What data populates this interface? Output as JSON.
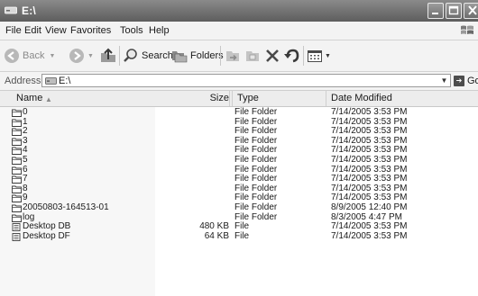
{
  "window": {
    "title": "E:\\"
  },
  "menu": {
    "file": "File",
    "edit": "Edit",
    "view": "View",
    "favorites": "Favorites",
    "tools": "Tools",
    "help": "Help"
  },
  "toolbar": {
    "back": "Back",
    "search": "Search",
    "folders": "Folders"
  },
  "address": {
    "label": "Address",
    "value": "E:\\",
    "go": "Go"
  },
  "columns": {
    "name": "Name",
    "size": "Size",
    "type": "Type",
    "date": "Date Modified"
  },
  "files": [
    {
      "name": "0",
      "size": "",
      "type": "File Folder",
      "date": "7/14/2005 3:53 PM",
      "icon": "folder"
    },
    {
      "name": "1",
      "size": "",
      "type": "File Folder",
      "date": "7/14/2005 3:53 PM",
      "icon": "folder"
    },
    {
      "name": "2",
      "size": "",
      "type": "File Folder",
      "date": "7/14/2005 3:53 PM",
      "icon": "folder"
    },
    {
      "name": "3",
      "size": "",
      "type": "File Folder",
      "date": "7/14/2005 3:53 PM",
      "icon": "folder"
    },
    {
      "name": "4",
      "size": "",
      "type": "File Folder",
      "date": "7/14/2005 3:53 PM",
      "icon": "folder"
    },
    {
      "name": "5",
      "size": "",
      "type": "File Folder",
      "date": "7/14/2005 3:53 PM",
      "icon": "folder"
    },
    {
      "name": "6",
      "size": "",
      "type": "File Folder",
      "date": "7/14/2005 3:53 PM",
      "icon": "folder"
    },
    {
      "name": "7",
      "size": "",
      "type": "File Folder",
      "date": "7/14/2005 3:53 PM",
      "icon": "folder"
    },
    {
      "name": "8",
      "size": "",
      "type": "File Folder",
      "date": "7/14/2005 3:53 PM",
      "icon": "folder"
    },
    {
      "name": "9",
      "size": "",
      "type": "File Folder",
      "date": "7/14/2005 3:53 PM",
      "icon": "folder"
    },
    {
      "name": "20050803-164513-01",
      "size": "",
      "type": "File Folder",
      "date": "8/9/2005 12:40 PM",
      "icon": "folder"
    },
    {
      "name": "log",
      "size": "",
      "type": "File Folder",
      "date": "8/3/2005 4:47 PM",
      "icon": "folder"
    },
    {
      "name": "Desktop DB",
      "size": "480 KB",
      "type": "File",
      "date": "7/14/2005 3:53 PM",
      "icon": "file"
    },
    {
      "name": "Desktop DF",
      "size": "64 KB",
      "type": "File",
      "date": "7/14/2005 3:53 PM",
      "icon": "file"
    }
  ]
}
